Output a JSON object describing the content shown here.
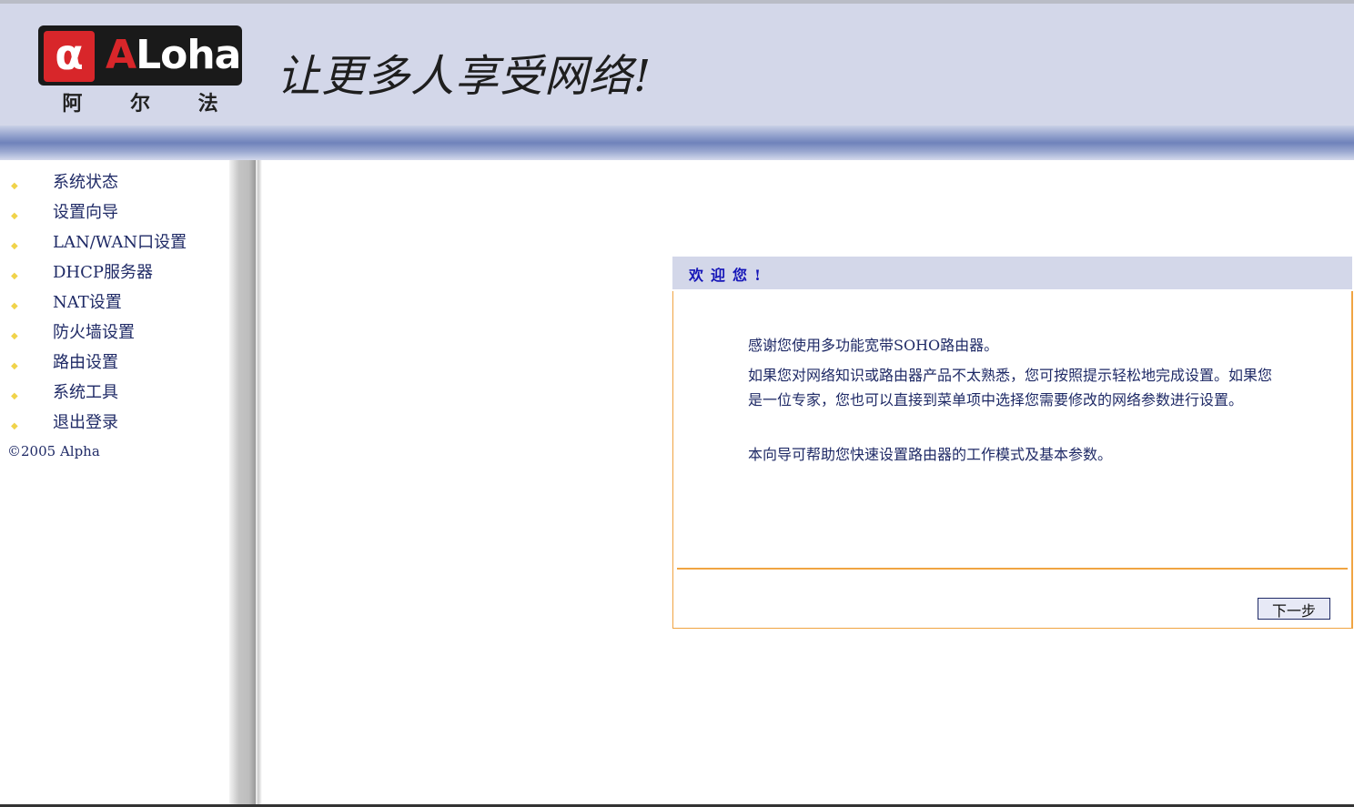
{
  "header": {
    "logo_mark": "α",
    "logo_word_first": "A",
    "logo_word_rest": "Loha",
    "logo_sub": [
      "阿",
      "尔",
      "法"
    ],
    "slogan": "让更多人享受网络!"
  },
  "sidebar": {
    "items": [
      {
        "label": "系统状态"
      },
      {
        "label": "设置向导"
      },
      {
        "label": "LAN/WAN口设置"
      },
      {
        "label": "DHCP服务器"
      },
      {
        "label": "NAT设置"
      },
      {
        "label": "防火墙设置"
      },
      {
        "label": "路由设置"
      },
      {
        "label": "系统工具"
      },
      {
        "label": "退出登录"
      }
    ],
    "bullet": "◆",
    "copyright": "©2005 Alpha"
  },
  "welcome": {
    "title": "欢迎您!",
    "paragraphs": [
      "感谢您使用多功能宽带SOHO路由器。",
      "如果您对网络知识或路由器产品不太熟悉，您可按照提示轻松地完成设置。如果您是一位专家，您也可以直接到菜单项中选择您需要修改的网络参数进行设置。",
      "本向导可帮助您快速设置路由器的工作模式及基本参数。"
    ],
    "next_button": "下一步"
  },
  "colors": {
    "header_bg": "#d3d7e9",
    "accent_orange": "#f0a442",
    "text_navy": "#1f2a66",
    "title_blue": "#1515b8",
    "bullet_yellow": "#f0d34a"
  }
}
